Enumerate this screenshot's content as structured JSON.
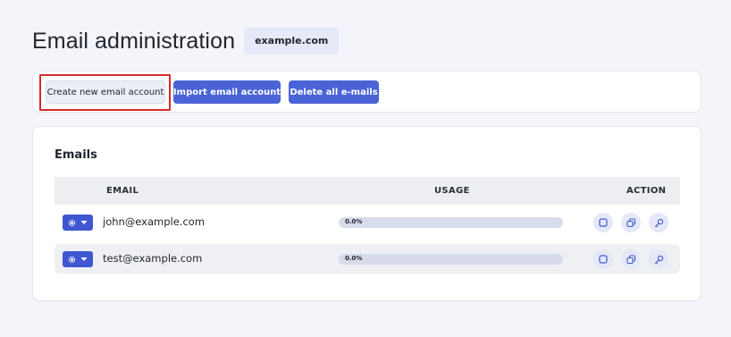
{
  "header": {
    "title": "Email administration",
    "domain": "example.com"
  },
  "toolbar": {
    "create_label": "Create new email account",
    "import_label": "Import email account",
    "delete_label": "Delete all e-mails"
  },
  "emails": {
    "title": "Emails",
    "columns": [
      "EMAIL",
      "USAGE",
      "ACTION"
    ],
    "rows": [
      {
        "email": "john@example.com",
        "usage_text": "0.0%",
        "usage_percent": 0
      },
      {
        "email": "test@example.com",
        "usage_text": "0.0%",
        "usage_percent": 0
      }
    ],
    "row_icons": [
      "gear-icon",
      "chevron-down-icon"
    ],
    "action_icons": [
      "square-icon",
      "copy-icon",
      "key-icon"
    ]
  },
  "colors": {
    "accent": "#4a63d6",
    "highlight": "#d82a2a",
    "background": "#f4f5fa"
  }
}
